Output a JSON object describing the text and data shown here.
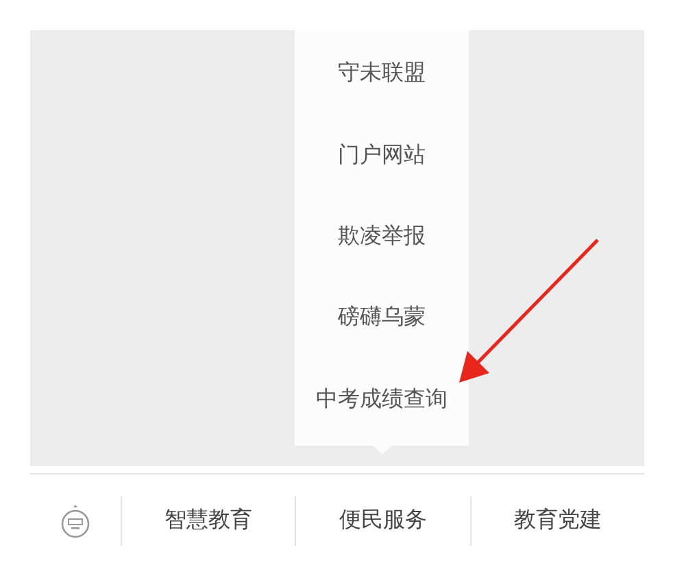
{
  "submenu": {
    "items": [
      {
        "label": "守未联盟"
      },
      {
        "label": "门户网站"
      },
      {
        "label": "欺凌举报"
      },
      {
        "label": "磅礴乌蒙"
      },
      {
        "label": "中考成绩查询"
      }
    ]
  },
  "menu_bar": {
    "items": [
      {
        "label": "智慧教育"
      },
      {
        "label": "便民服务"
      },
      {
        "label": "教育党建"
      }
    ]
  }
}
